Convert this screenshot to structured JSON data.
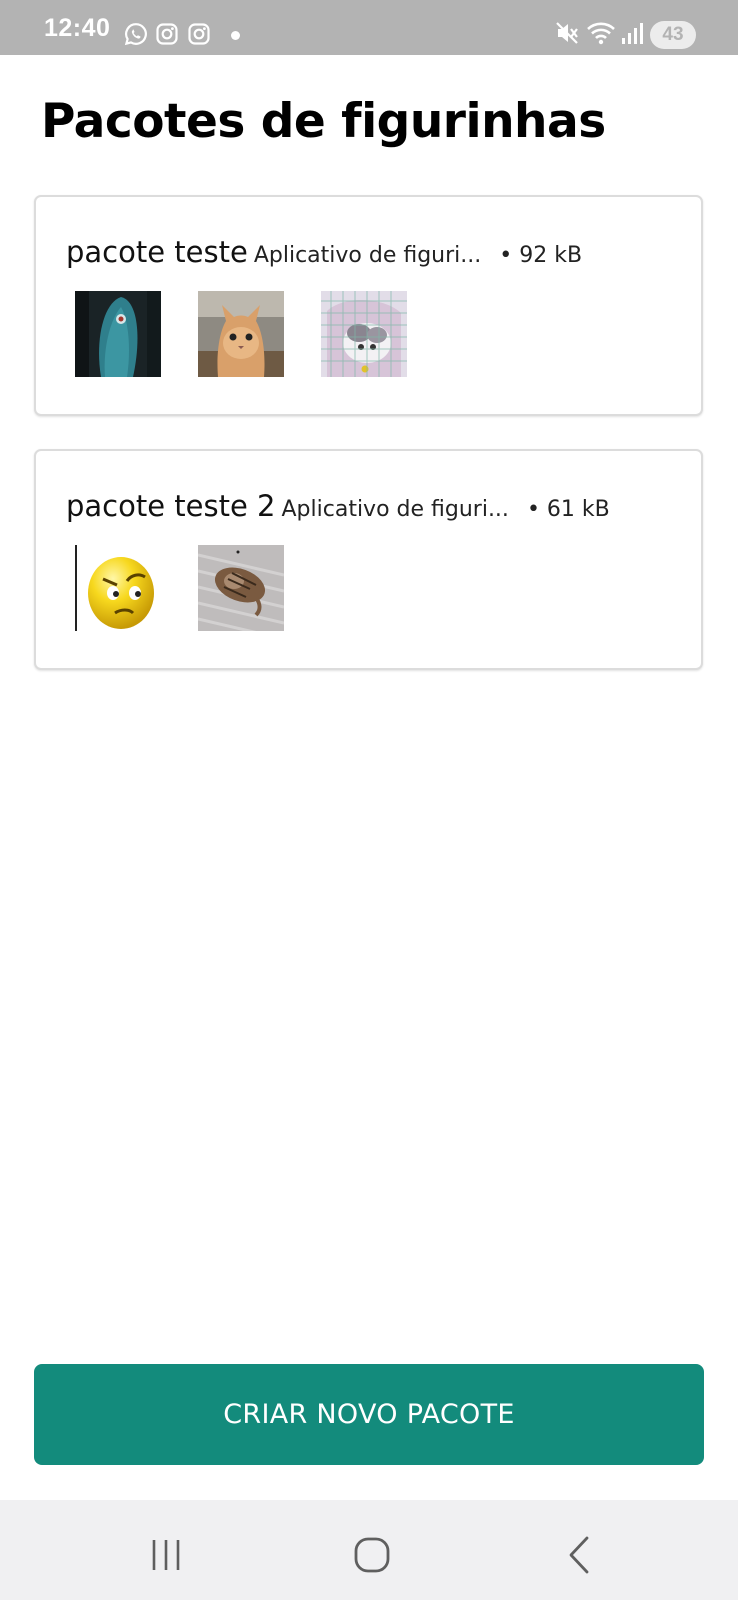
{
  "status_bar": {
    "time": "12:40",
    "left_icons": [
      "whatsapp-icon",
      "instagram-icon",
      "instagram-icon",
      "notification-dot"
    ],
    "right_icons": [
      "mute-icon",
      "wifi-icon",
      "signal-icon"
    ],
    "battery": "43"
  },
  "page": {
    "title": "Pacotes de figurinhas"
  },
  "packs": [
    {
      "name": "pacote teste",
      "description": "Aplicativo de figuri...",
      "size": "• 92 kB",
      "stickers": [
        "fish-sticker",
        "cat-face-sticker",
        "cat-in-cage-sticker"
      ]
    },
    {
      "name": "pacote teste 2",
      "description": "Aplicativo de figuri...",
      "size": "• 61 kB",
      "stickers": [
        "angry-emoji-sticker",
        "sleeping-cat-sticker"
      ]
    }
  ],
  "create_button": {
    "label": "CRIAR NOVO PACOTE"
  },
  "nav_bar": {
    "buttons": [
      "recent-apps-icon",
      "home-icon",
      "back-icon"
    ]
  },
  "colors": {
    "accent": "#138b7c",
    "status_bar": "#b3b3b3",
    "nav_bar": "#f0f0f2"
  }
}
